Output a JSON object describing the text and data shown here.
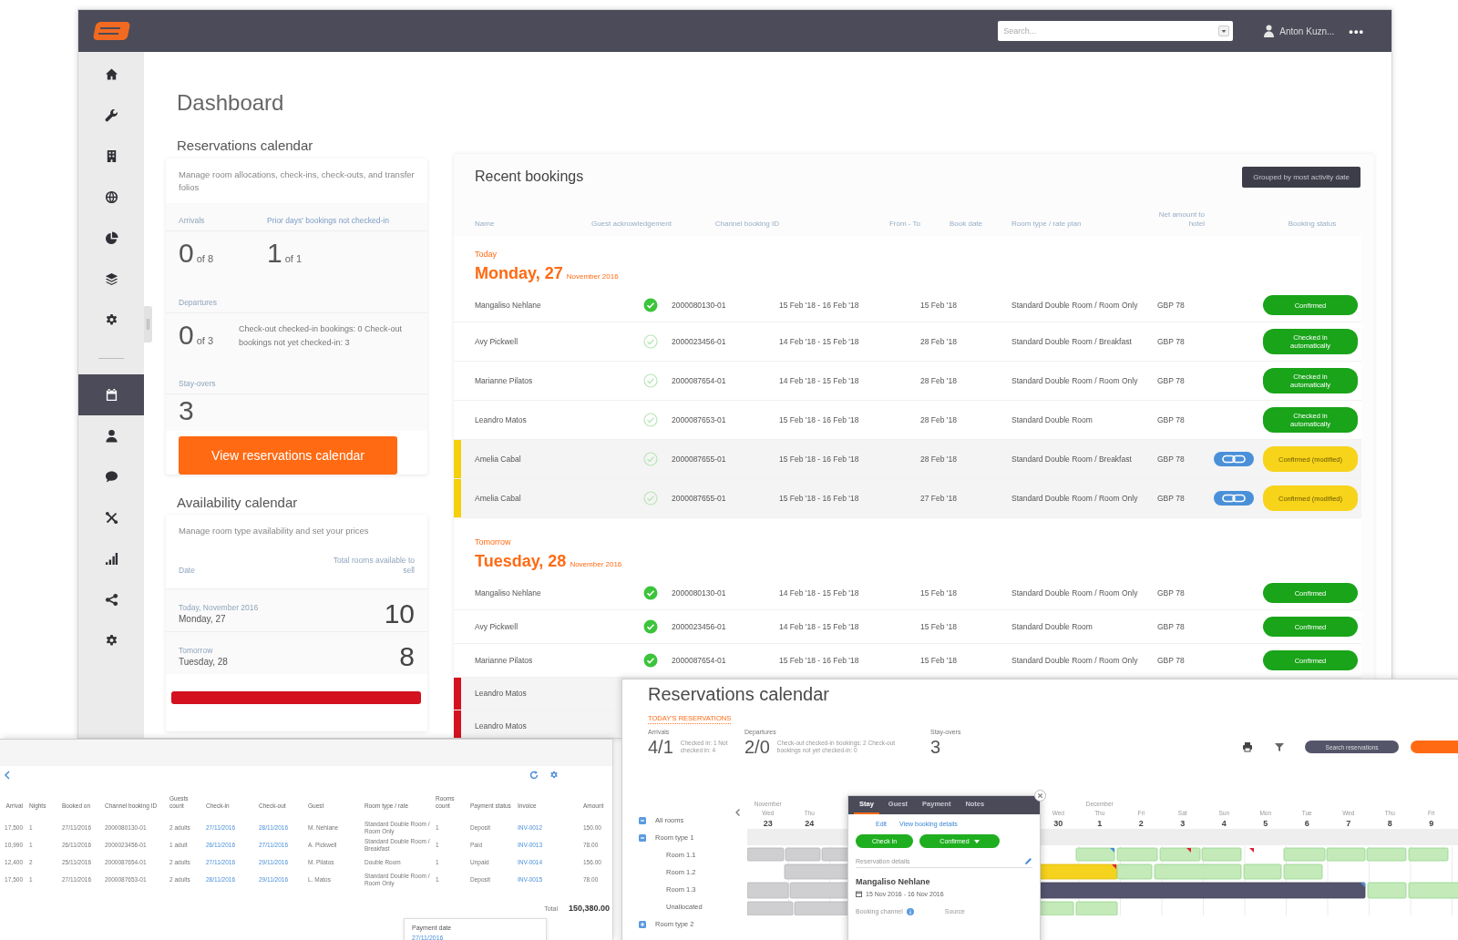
{
  "dashboard_window": {
    "top_bar": {
      "search": {
        "placeholder": "Search..."
      },
      "user_name": "Anton Kuzn...",
      "more_menu": "•••"
    },
    "sidebar": {
      "groups": [
        {
          "items": [
            {
              "selected": false
            },
            {
              "selected": false
            },
            {
              "selected": false
            },
            {
              "selected": false
            },
            {
              "selected": false
            },
            {
              "selected": false
            },
            {
              "selected": false
            }
          ]
        },
        {
          "items": [
            {
              "selected": true
            },
            {
              "selected": false
            },
            {
              "selected": false
            },
            {
              "selected": false
            },
            {
              "selected": false
            },
            {
              "selected": false
            },
            {
              "selected": false
            }
          ]
        }
      ]
    },
    "page_title": "Dashboard",
    "reservations_calendar": {
      "title": "Reservations calendar",
      "description": "Manage room allocations, check-ins, check-outs, and transfer folios",
      "arrivals": {
        "label": "Arrivals",
        "value": "0",
        "total": "of 8"
      },
      "prior_days": {
        "label": "Prior days' bookings not checked-in",
        "value": "1",
        "total": "of 1"
      },
      "departures": {
        "label": "Departures",
        "value": "0",
        "total": "of 3",
        "note": "Check-out checked-in bookings: 0 Check-out bookings not yet checked-in: 3"
      },
      "stay_overs": {
        "label": "Stay-overs",
        "value": "3"
      },
      "button": "View reservations calendar"
    },
    "availability_calendar": {
      "title": "Availability calendar",
      "description": "Manage room type availability and set your prices",
      "columns": [
        "Date",
        "Total rooms available to sell"
      ],
      "rows": [
        {
          "caption": "Today, November 2016",
          "day": "Monday, 27",
          "rooms": "10"
        },
        {
          "caption": "Tomorrow",
          "day": "Tuesday, 28",
          "rooms": "8"
        }
      ]
    },
    "recent_bookings": {
      "title": "Recent bookings",
      "sort_button": "Grouped by most activity date",
      "columns": [
        "Name",
        "Guest acknowledgement",
        "Channel booking ID",
        "From - To",
        "Book date",
        "Room type / rate plan",
        "Net amount to hotel",
        "Booking status"
      ],
      "groups": [
        {
          "caption": "Today",
          "day": "Monday, 27",
          "month": "November 2016",
          "rows": [
            {
              "name": "Mangaliso Nehlane",
              "acknowledged": true,
              "booking_id": "2000080130-01",
              "dates": "15 Feb '18 - 16 Feb '18",
              "book_date": "15 Feb '18",
              "room": "Standard Double Room / Room Only",
              "net": "GBP 78",
              "linked": false,
              "status": {
                "kind": "confirmed",
                "text": "Confirmed"
              }
            },
            {
              "name": "Avy Pickwell",
              "acknowledged": false,
              "booking_id": "2000023456-01",
              "dates": "14 Feb '18 - 15 Feb '18",
              "book_date": "28 Feb '18",
              "room": "Standard Double Room / Breakfast",
              "net": "GBP 78",
              "linked": false,
              "status": {
                "kind": "checked_in",
                "text": "Checked in automatically"
              }
            },
            {
              "name": "Marianne Pilatos",
              "acknowledged": false,
              "booking_id": "2000087654-01",
              "dates": "14 Feb '18 - 15 Feb '18",
              "book_date": "28 Feb '18",
              "room": "Standard Double Room / Room Only",
              "net": "GBP 78",
              "linked": false,
              "status": {
                "kind": "checked_in",
                "text": "Checked in automatically"
              }
            },
            {
              "name": "Leandro Matos",
              "acknowledged": false,
              "booking_id": "2000087653-01",
              "dates": "15 Feb '18 - 16 Feb '18",
              "book_date": "28 Feb '18",
              "room": "Standard Double Room",
              "net": "GBP 78",
              "linked": false,
              "status": {
                "kind": "checked_in",
                "text": "Checked in automatically"
              }
            },
            {
              "name": "Amelia Cabal",
              "acknowledged": false,
              "booking_id": "2000087655-01",
              "dates": "15 Feb '18 - 16 Feb '18",
              "book_date": "28 Feb '18",
              "room": "Standard Double Room / Breakfast",
              "net": "GBP 78",
              "linked": true,
              "status": {
                "kind": "modified",
                "text": "Confirmed (modified)"
              },
              "color": "#f5cf0a"
            },
            {
              "name": "Amelia Cabal",
              "acknowledged": false,
              "booking_id": "2000087655-01",
              "dates": "15 Feb '18 - 16 Feb '18",
              "book_date": "27 Feb '18",
              "room": "Standard Double Room / Room Only",
              "net": "GBP 78",
              "linked": true,
              "status": {
                "kind": "modified",
                "text": "Confirmed (modified)"
              },
              "color": "#f5cf0a"
            }
          ]
        },
        {
          "caption": "Tomorrow",
          "day": "Tuesday, 28",
          "month": "November 2016",
          "rows": [
            {
              "name": "Mangaliso Nehlane",
              "acknowledged": true,
              "booking_id": "2000080130-01",
              "dates": "14 Feb '18 - 15 Feb '18",
              "book_date": "15 Feb '18",
              "room": "Standard Double Room / Room Only",
              "net": "GBP 78",
              "linked": false,
              "status": {
                "kind": "confirmed",
                "text": "Confirmed"
              }
            },
            {
              "name": "Avy Pickwell",
              "acknowledged": true,
              "booking_id": "2000023456-01",
              "dates": "14 Feb '18 - 15 Feb '18",
              "book_date": "15 Feb '18",
              "room": "Standard Double Room",
              "net": "GBP 78",
              "linked": false,
              "status": {
                "kind": "confirmed",
                "text": "Confirmed"
              }
            },
            {
              "name": "Marianne Pilatos",
              "acknowledged": true,
              "booking_id": "2000087654-01",
              "dates": "15 Feb '18 - 16 Feb '18",
              "book_date": "15 Feb '18",
              "room": "Standard Double Room / Room Only",
              "net": "GBP 78",
              "linked": false,
              "status": {
                "kind": "confirmed",
                "text": "Confirmed"
              }
            },
            {
              "name": "Leandro Matos",
              "color": "#d4111f"
            },
            {
              "name": "Leandro Matos",
              "color": "#d4111f"
            }
          ]
        }
      ]
    }
  },
  "bookings_list_window": {
    "columns": [
      {
        "label": "Arrival",
        "kind": "text"
      },
      {
        "label": "Nights",
        "kind": "text"
      },
      {
        "label": "Booked on",
        "kind": "text"
      },
      {
        "label": "Channel booking ID",
        "kind": "text"
      },
      {
        "label": "Guests count",
        "kind": "text"
      },
      {
        "label": "Check-in",
        "kind": "link"
      },
      {
        "label": "Check-out",
        "kind": "link"
      },
      {
        "label": "Guest",
        "kind": "text"
      },
      {
        "label": "Room type / rate",
        "kind": "text"
      },
      {
        "label": "Rooms count",
        "kind": "text"
      },
      {
        "label": "Payment status",
        "kind": "text"
      },
      {
        "label": "Invoice",
        "kind": "link"
      },
      {
        "label": "Amount",
        "kind": "text"
      }
    ],
    "rows": [
      [
        "17,500",
        "1",
        "27/11/2016",
        "2000080130-01",
        "2 adults",
        "27/11/2016",
        "28/11/2016",
        "M. Nehlane",
        "Standard Double Room / Room Only",
        "1",
        "Deposit",
        "INV-0012",
        "150.00"
      ],
      [
        "10,990",
        "1",
        "26/11/2016",
        "2000023456-01",
        "1 adult",
        "26/11/2016",
        "27/11/2016",
        "A. Pickwell",
        "Standard Double Room / Breakfast",
        "1",
        "Paid",
        "INV-0013",
        "78.00"
      ],
      [
        "12,400",
        "2",
        "25/11/2016",
        "2000087654-01",
        "2 adults",
        "27/11/2016",
        "29/11/2016",
        "M. Pilatos",
        "Double Room",
        "1",
        "Unpaid",
        "INV-0014",
        "156.00"
      ],
      [
        "17,500",
        "1",
        "27/11/2016",
        "2000087653-01",
        "2 adults",
        "28/11/2016",
        "29/11/2016",
        "L. Matos",
        "Standard Double Room / Room Only",
        "1",
        "Deposit",
        "INV-0015",
        "78.00"
      ]
    ],
    "total": {
      "label": "Total",
      "amount": "150,380.00"
    },
    "tooltip": {
      "title": "Payment date",
      "value": "27/11/2016"
    }
  },
  "calendar_window": {
    "title": "Reservations calendar",
    "summary_link": "TODAY'S RESERVATIONS",
    "stats": [
      {
        "label": "Arrivals",
        "value": "4/1",
        "note": "Checked in: 1 Not checked in: 4"
      },
      {
        "label": "Departures",
        "value": "2/0",
        "note": "Check-out checked-in bookings: 2 Check-out bookings not yet checked-in: 0"
      },
      {
        "label": "Stay-overs",
        "value": "3"
      }
    ],
    "search_button": "Search reservations",
    "room_tree": [
      {
        "label": "All rooms",
        "expanded": true
      },
      {
        "label": "Room type 1",
        "expanded": true,
        "children": [
          {
            "label": "Room 1.1"
          },
          {
            "label": "Room 1.2"
          },
          {
            "label": "Room 1.3"
          },
          {
            "label": "Unallocated"
          }
        ]
      },
      {
        "label": "Room type 2",
        "expanded": false
      }
    ],
    "days": [
      {
        "month": "November",
        "weekday": "Wed",
        "day": "23"
      },
      {
        "weekday": "Thu",
        "day": "24"
      },
      {
        "weekday": "Wed",
        "day": "30"
      },
      {
        "month": "December",
        "weekday": "Thu",
        "day": "1"
      },
      {
        "weekday": "Fri",
        "day": "2"
      },
      {
        "weekday": "Sat",
        "day": "3"
      },
      {
        "weekday": "Sun",
        "day": "4"
      },
      {
        "weekday": "Mon",
        "day": "5"
      },
      {
        "weekday": "Tue",
        "day": "6"
      },
      {
        "weekday": "Wed",
        "day": "7"
      },
      {
        "weekday": "Thu",
        "day": "8"
      },
      {
        "weekday": "Fri",
        "day": "9"
      }
    ],
    "popup": {
      "tabs": [
        {
          "label": "Stay",
          "selected": true
        },
        {
          "label": "Guest",
          "selected": false
        },
        {
          "label": "Payment",
          "selected": false
        },
        {
          "label": "Notes",
          "selected": false
        }
      ],
      "links": [
        "Edit",
        "View booking details"
      ],
      "buttons": [
        {
          "label": "Check in",
          "kind": "plain"
        },
        {
          "label": "Confirmed",
          "kind": "dropdown"
        }
      ],
      "section_label": "Reservation details",
      "guest_name": "Mangaliso Nehlane",
      "dates": "15 Nov 2016 - 16 Nov 2016",
      "fields": [
        {
          "label": "Booking channel",
          "kind": "info"
        },
        {
          "label": "Source",
          "kind": "plain"
        }
      ]
    }
  }
}
